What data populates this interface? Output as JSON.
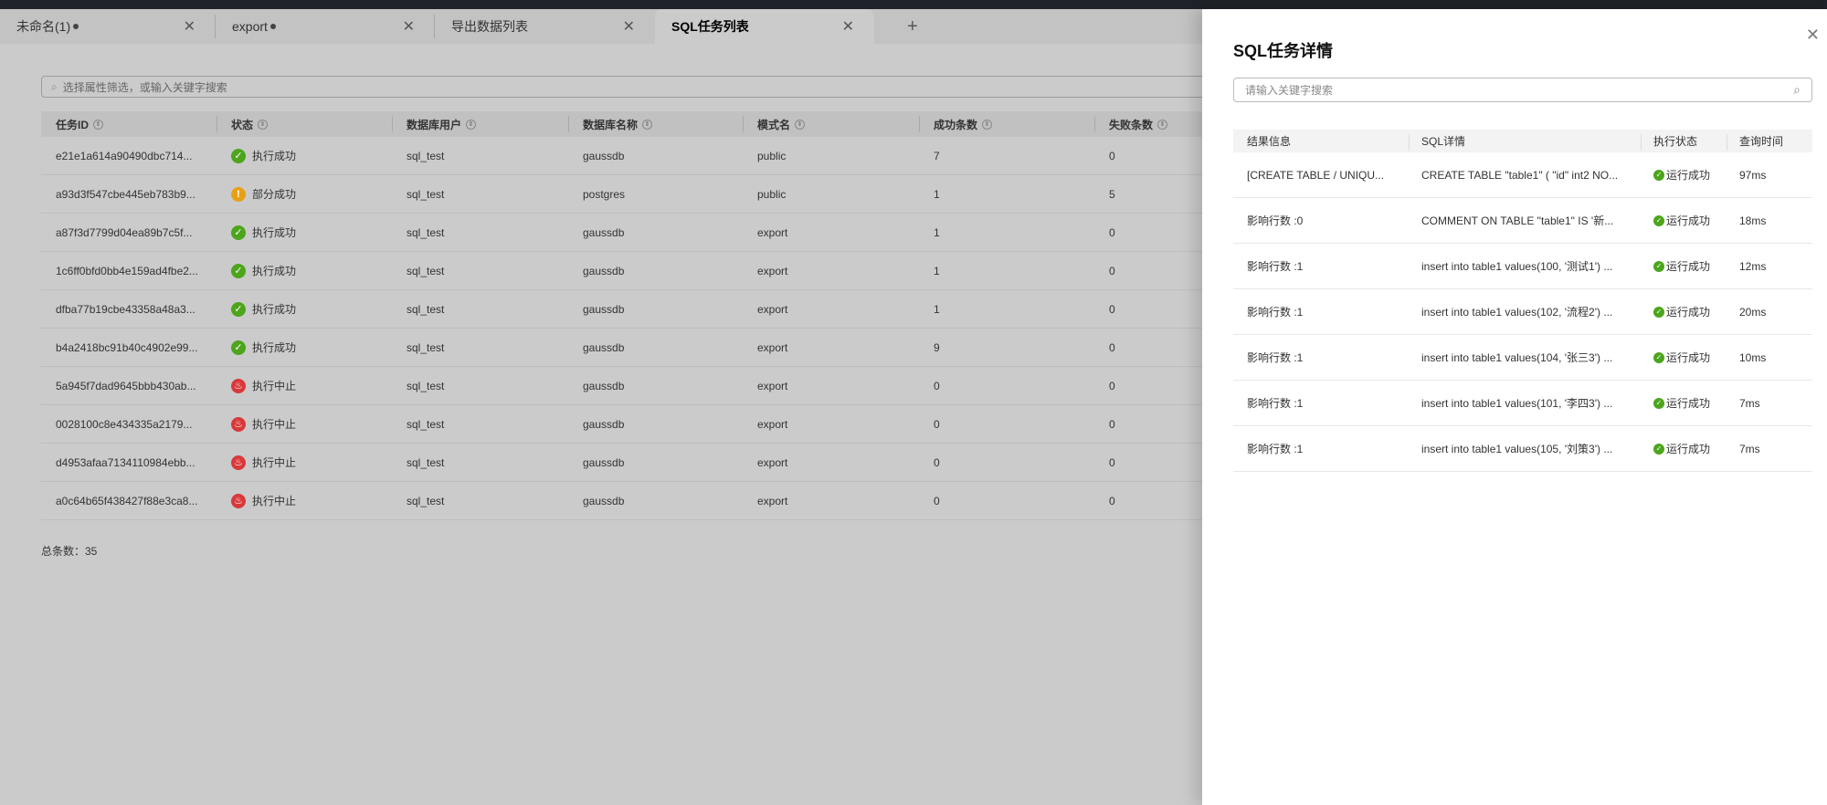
{
  "tabs": [
    {
      "label": "未命名(1)",
      "dirty": true
    },
    {
      "label": "export",
      "dirty": true
    },
    {
      "label": "导出数据列表",
      "dirty": false
    },
    {
      "label": "SQL任务列表",
      "dirty": false,
      "active": true
    }
  ],
  "search": {
    "placeholder": "选择属性筛选，或输入关键字搜索"
  },
  "table": {
    "headers": [
      "任务ID",
      "状态",
      "数据库用户",
      "数据库名称",
      "模式名",
      "成功条数",
      "失败条数"
    ],
    "rows": [
      [
        "e21e1a614a90490dbc714...",
        "执行成功",
        "sql_test",
        "gaussdb",
        "public",
        "7",
        "0",
        "success"
      ],
      [
        "a93d3f547cbe445eb783b9...",
        "部分成功",
        "sql_test",
        "postgres",
        "public",
        "1",
        "5",
        "partial"
      ],
      [
        "a87f3d7799d04ea89b7c5f...",
        "执行成功",
        "sql_test",
        "gaussdb",
        "export",
        "1",
        "0",
        "success"
      ],
      [
        "1c6ff0bfd0bb4e159ad4fbe2...",
        "执行成功",
        "sql_test",
        "gaussdb",
        "export",
        "1",
        "0",
        "success"
      ],
      [
        "dfba77b19cbe43358a48a3...",
        "执行成功",
        "sql_test",
        "gaussdb",
        "export",
        "1",
        "0",
        "success"
      ],
      [
        "b4a2418bc91b40c4902e99...",
        "执行成功",
        "sql_test",
        "gaussdb",
        "export",
        "9",
        "0",
        "success"
      ],
      [
        "5a945f7dad9645bbb430ab...",
        "执行中止",
        "sql_test",
        "gaussdb",
        "export",
        "0",
        "0",
        "aborted"
      ],
      [
        "0028100c8e434335a2179...",
        "执行中止",
        "sql_test",
        "gaussdb",
        "export",
        "0",
        "0",
        "aborted"
      ],
      [
        "d4953afaa7134110984ebb...",
        "执行中止",
        "sql_test",
        "gaussdb",
        "export",
        "0",
        "0",
        "aborted"
      ],
      [
        "a0c64b65f438427f88e3ca8...",
        "执行中止",
        "sql_test",
        "gaussdb",
        "export",
        "0",
        "0",
        "aborted"
      ]
    ]
  },
  "total": "总条数：35",
  "drawer": {
    "title": "SQL任务详情",
    "search_placeholder": "请输入关键字搜索",
    "headers": [
      "结果信息",
      "SQL详情",
      "执行状态",
      "查询时间"
    ],
    "rows": [
      [
        "[CREATE TABLE / UNIQU...",
        "CREATE TABLE \"table1\" ( \"id\" int2 NO...",
        "运行成功",
        "97ms"
      ],
      [
        "影响行数 :0",
        "COMMENT ON TABLE \"table1\" IS '新...",
        "运行成功",
        "18ms"
      ],
      [
        "影响行数 :1",
        "insert into table1 values(100, '测试1') ...",
        "运行成功",
        "12ms"
      ],
      [
        "影响行数 :1",
        "insert into table1 values(102, '流程2') ...",
        "运行成功",
        "20ms"
      ],
      [
        "影响行数 :1",
        "insert into table1 values(104, '张三3') ...",
        "运行成功",
        "10ms"
      ],
      [
        "影响行数 :1",
        "insert into table1 values(101, '李四3') ...",
        "运行成功",
        "7ms"
      ],
      [
        "影响行数 :1",
        "insert into table1 values(105, '刘策3') ...",
        "运行成功",
        "7ms"
      ]
    ]
  },
  "colors": {
    "success": "#4ca51b",
    "partial": "#e6a117",
    "aborted": "#d9383a"
  }
}
